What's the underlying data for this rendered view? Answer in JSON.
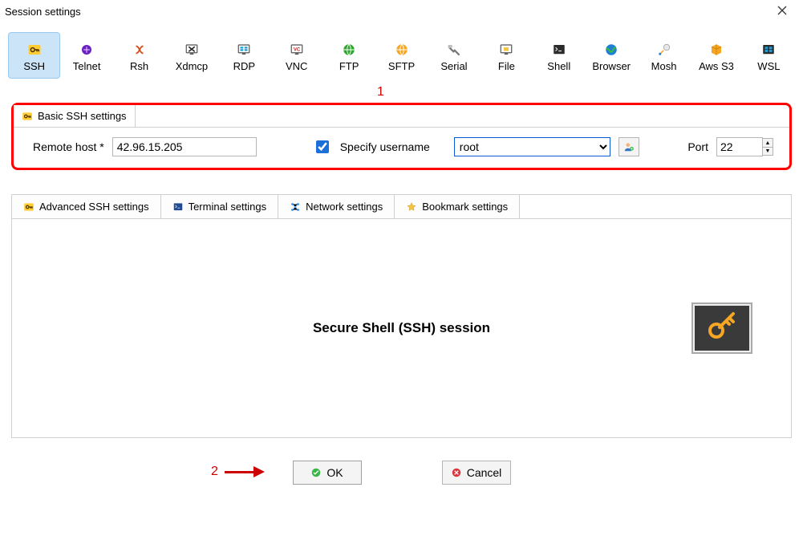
{
  "window": {
    "title": "Session settings"
  },
  "annotations": {
    "n1": "1",
    "n2": "2"
  },
  "protocols": [
    {
      "id": "ssh",
      "label": "SSH",
      "selected": true
    },
    {
      "id": "telnet",
      "label": "Telnet",
      "selected": false
    },
    {
      "id": "rsh",
      "label": "Rsh",
      "selected": false
    },
    {
      "id": "xdmcp",
      "label": "Xdmcp",
      "selected": false
    },
    {
      "id": "rdp",
      "label": "RDP",
      "selected": false
    },
    {
      "id": "vnc",
      "label": "VNC",
      "selected": false
    },
    {
      "id": "ftp",
      "label": "FTP",
      "selected": false
    },
    {
      "id": "sftp",
      "label": "SFTP",
      "selected": false
    },
    {
      "id": "serial",
      "label": "Serial",
      "selected": false
    },
    {
      "id": "file",
      "label": "File",
      "selected": false
    },
    {
      "id": "shell",
      "label": "Shell",
      "selected": false
    },
    {
      "id": "browser",
      "label": "Browser",
      "selected": false
    },
    {
      "id": "mosh",
      "label": "Mosh",
      "selected": false
    },
    {
      "id": "awss3",
      "label": "Aws S3",
      "selected": false
    },
    {
      "id": "wsl",
      "label": "WSL",
      "selected": false
    }
  ],
  "basic": {
    "tab_label": "Basic SSH settings",
    "remote_host_label": "Remote host *",
    "remote_host_value": "42.96.15.205",
    "specify_username_label": "Specify username",
    "specify_username_checked": true,
    "username_value": "root",
    "port_label": "Port",
    "port_value": "22"
  },
  "advanced_tabs": {
    "t1": "Advanced SSH settings",
    "t2": "Terminal settings",
    "t3": "Network settings",
    "t4": "Bookmark settings"
  },
  "main_caption": "Secure Shell (SSH) session",
  "buttons": {
    "ok": "OK",
    "cancel": "Cancel"
  }
}
